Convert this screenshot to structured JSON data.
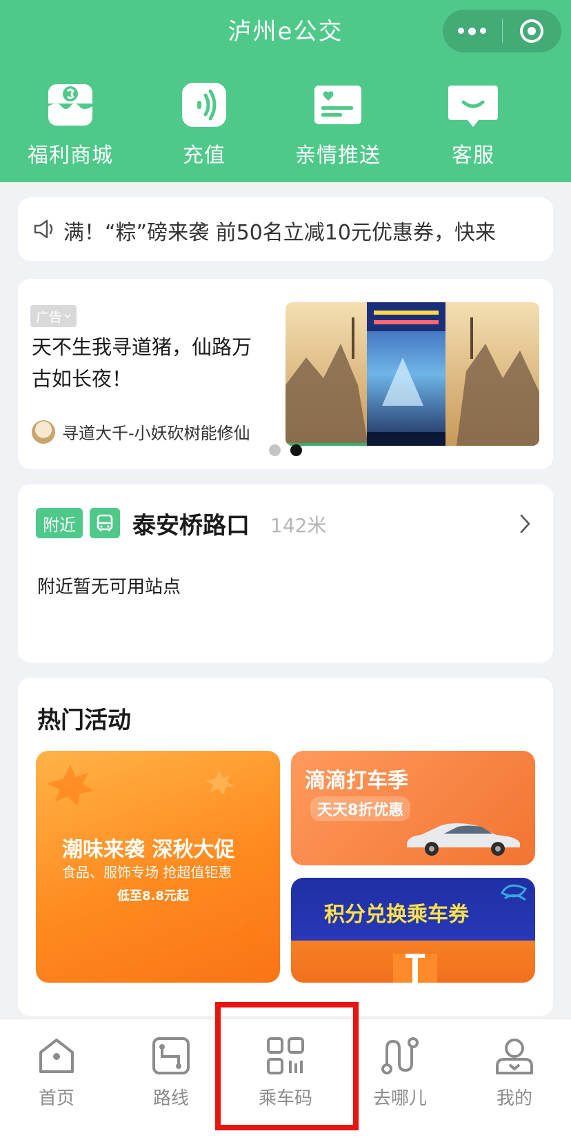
{
  "app": {
    "title": "泸州e公交"
  },
  "colors": {
    "brand_green": "#4ec98a",
    "highlight_red": "#e8140f",
    "pager_active": "#111111"
  },
  "capsule": {
    "more_icon": "more-dots-icon",
    "close_icon": "target-icon"
  },
  "quick_actions": [
    {
      "label": "福利商城",
      "icon": "shop-icon"
    },
    {
      "label": "充值",
      "icon": "recharge-icon"
    },
    {
      "label": "亲情推送",
      "icon": "family-push-icon"
    },
    {
      "label": "客服",
      "icon": "customer-service-icon"
    }
  ],
  "notice": {
    "icon": "speaker-icon",
    "text": "满！“粽”磅来袭 前50名立减10元优惠券，快来"
  },
  "ad": {
    "tag": "广告",
    "title": "天不生我寻道猪，仙路万古如长夜！",
    "source": "寻道大千-小妖砍树能修仙",
    "pager": {
      "total": 2,
      "active": 2
    }
  },
  "nearby": {
    "badge": "附近",
    "station": "泰安桥路口",
    "distance": "142米",
    "empty_text": "附近暂无可用站点"
  },
  "hot": {
    "title": "热门活动",
    "promos": [
      {
        "headline": "潮味来袭 深秋大促",
        "sub": "食品、服饰专场 抢超值钜惠",
        "small": "低至8.8元起"
      },
      {
        "headline": "滴滴打车季",
        "sub": "天天8折优惠"
      },
      {
        "headline": "积分兑换乘车券"
      }
    ]
  },
  "tabbar": {
    "items": [
      {
        "label": "首页",
        "icon": "home-icon"
      },
      {
        "label": "路线",
        "icon": "route-icon"
      },
      {
        "label": "乘车码",
        "icon": "ride-code-icon"
      },
      {
        "label": "去哪儿",
        "icon": "destination-icon"
      },
      {
        "label": "我的",
        "icon": "profile-icon"
      }
    ],
    "highlighted_index": 2
  }
}
